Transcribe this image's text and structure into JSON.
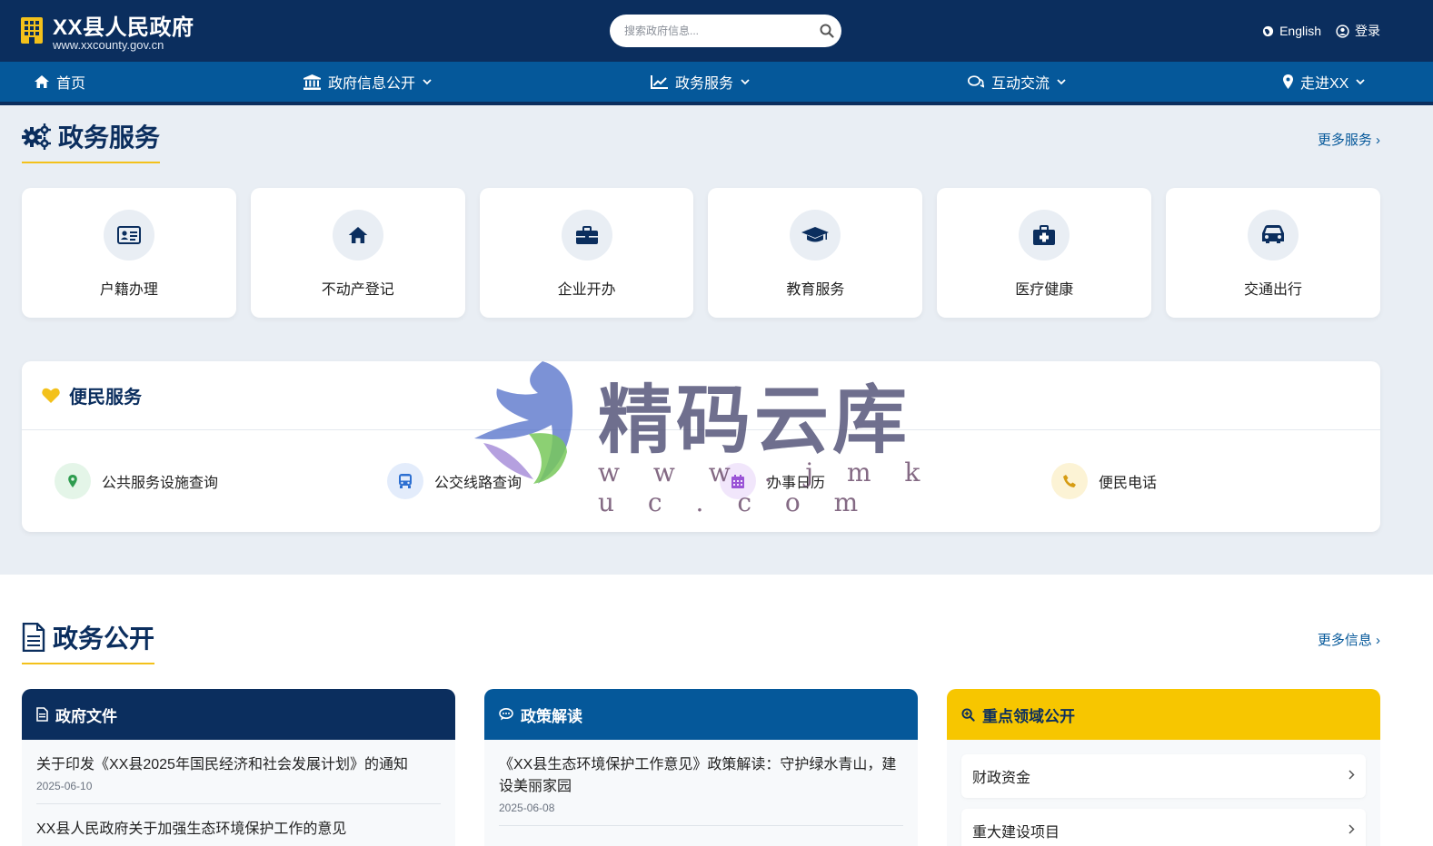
{
  "header": {
    "title": "XX县人民政府",
    "url": "www.xxcounty.gov.cn",
    "search_placeholder": "搜索政府信息...",
    "lang_label": "English",
    "login_label": "登录"
  },
  "nav": {
    "items": [
      {
        "label": "首页",
        "icon": "home-icon"
      },
      {
        "label": "政府信息公开",
        "icon": "institution-icon"
      },
      {
        "label": "政务服务",
        "icon": "chart-line-icon"
      },
      {
        "label": "互动交流",
        "icon": "comments-icon"
      },
      {
        "label": "走进XX",
        "icon": "map-marker-icon"
      }
    ]
  },
  "services": {
    "title": "政务服务",
    "more": "更多服务 ›",
    "cards": [
      {
        "label": "户籍办理",
        "icon": "id-card-icon"
      },
      {
        "label": "不动产登记",
        "icon": "home-icon"
      },
      {
        "label": "企业开办",
        "icon": "briefcase-icon"
      },
      {
        "label": "教育服务",
        "icon": "graduation-cap-icon"
      },
      {
        "label": "医疗健康",
        "icon": "medkit-icon"
      },
      {
        "label": "交通出行",
        "icon": "car-icon"
      }
    ]
  },
  "convenience": {
    "title": "便民服务",
    "items": [
      {
        "label": "公共服务设施查询",
        "icon": "map-marker-icon",
        "color": "#2e9c4f"
      },
      {
        "label": "公交线路查询",
        "icon": "bus-icon",
        "color": "#2c6fd1"
      },
      {
        "label": "办事日历",
        "icon": "calendar-icon",
        "color": "#9a54d6"
      },
      {
        "label": "便民电话",
        "icon": "phone-icon",
        "color": "#d69c13"
      }
    ]
  },
  "publicity": {
    "title": "政务公开",
    "more": "更多信息 ›",
    "columns": [
      {
        "title": "政府文件",
        "color": "#0b2e5e",
        "items": [
          {
            "title": "关于印发《XX县2025年国民经济和社会发展计划》的通知",
            "date": "2025-06-10"
          },
          {
            "title": "XX县人民政府关于加强生态环境保护工作的意见",
            "date": ""
          }
        ]
      },
      {
        "title": "政策解读",
        "color": "#05589a",
        "items": [
          {
            "title": "《XX县生态环境保护工作意见》政策解读：守护绿水青山，建设美丽家园",
            "date": "2025-06-08"
          }
        ]
      },
      {
        "title": "重点领域公开",
        "color": "#f7c600",
        "items": [
          {
            "title": "财政资金"
          },
          {
            "title": "重大建设项目"
          }
        ]
      }
    ]
  },
  "watermark": {
    "text": "精码云库",
    "url": "w w w . j m k u c . c o m"
  }
}
